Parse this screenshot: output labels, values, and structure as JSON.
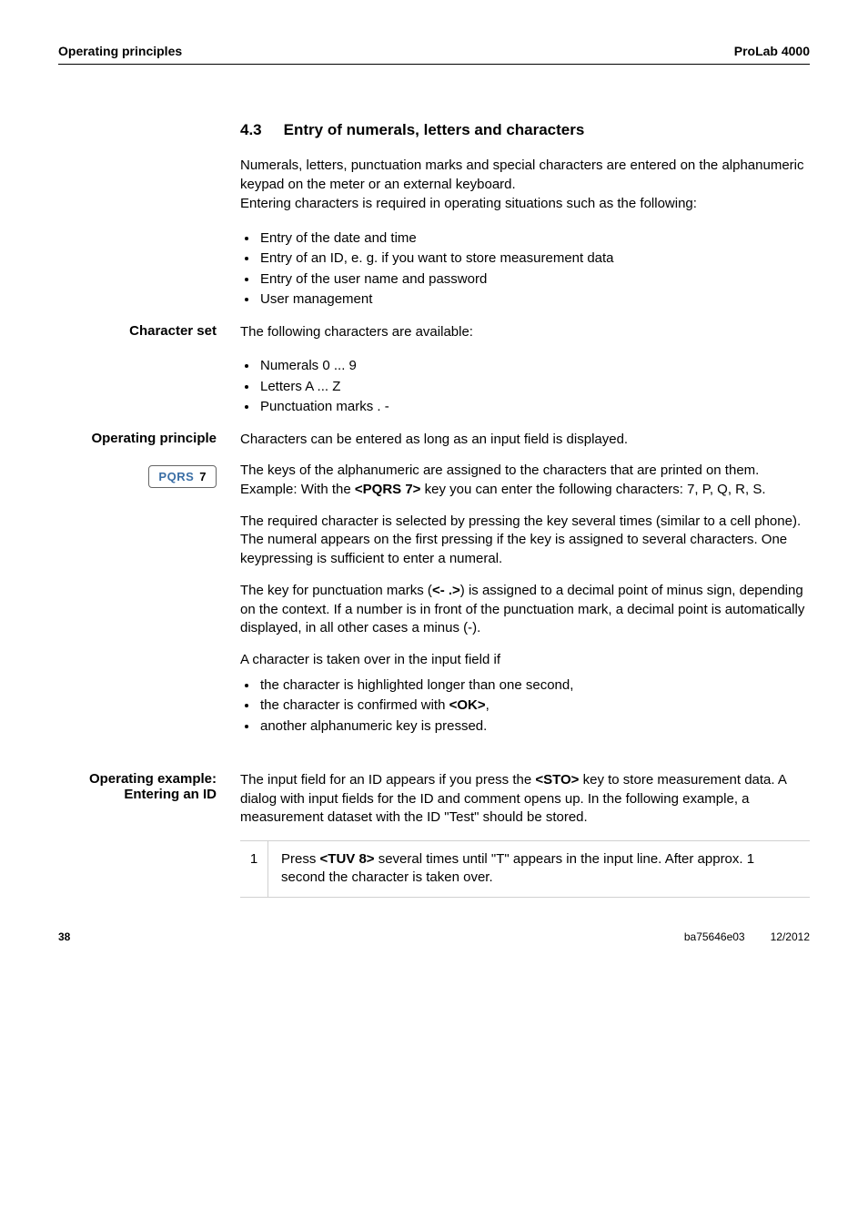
{
  "header": {
    "left": "Operating principles",
    "right": "ProLab 4000"
  },
  "section": {
    "number": "4.3",
    "title": "Entry of numerals, letters and characters"
  },
  "intro": {
    "p1a": "Numerals, letters, punctuation marks and special characters are entered on the alphanumeric keypad on the meter or an external keyboard.",
    "p1b": "Entering characters is required in operating situations such as the following:",
    "bullets": [
      "Entry of the date and time",
      "Entry of an ID, e. g. if you want to store measurement data",
      "Entry of the user name and password",
      "User management"
    ]
  },
  "character_set": {
    "label": "Character set",
    "lead": "The following characters are available:",
    "bullets": [
      "Numerals 0 ... 9",
      "Letters A ... Z",
      "Punctuation marks . -"
    ]
  },
  "operating_principle": {
    "label": "Operating principle",
    "lead": "Characters can be entered as long as an input field is displayed.",
    "key_letters": "PQRS",
    "key_num": "7",
    "p2a": "The keys of the alphanumeric are assigned to the characters that are printed on them. Example: With the ",
    "p2b": " key you can enter the following characters: 7, P, Q, R, S.",
    "key_label": "<PQRS 7>",
    "p3": "The required character is selected by pressing the key several times (similar to a cell phone). The numeral appears on the first pressing if the key is assigned to several characters. One keypressing is sufficient to enter a numeral.",
    "p4a": "The key for punctuation marks (",
    "p4b": ") is assigned to a decimal point of minus sign, depending on the context. If a number is in front of the punctuation mark, a decimal point is automatically displayed, in all other cases a minus (-).",
    "key_punc": "<- .>",
    "p5": "A character is taken over in the input field if",
    "bullets_a": "the character is highlighted longer than one second,",
    "bullets_b_pre": "the character is confirmed with ",
    "bullets_b_key": "<OK>",
    "bullets_b_post": ",",
    "bullets_c": "another alphanumeric key is pressed."
  },
  "operating_example": {
    "label_line1": "Operating example:",
    "label_line2": "Entering an ID",
    "p1a": "The input field for an ID appears if you press the ",
    "p1b": " key to store measurement data. A dialog with input fields for the ID and comment opens up. In the following example, a measurement dataset with the ID \"Test\" should be stored.",
    "key_sto": "<STO>",
    "step_num": "1",
    "step_a": "Press ",
    "step_key": "<TUV 8>",
    "step_b": " several times until \"T\" appears in the input line. After approx. 1 second the character is taken over."
  },
  "footer": {
    "page": "38",
    "doc": "ba75646e03",
    "date": "12/2012"
  }
}
